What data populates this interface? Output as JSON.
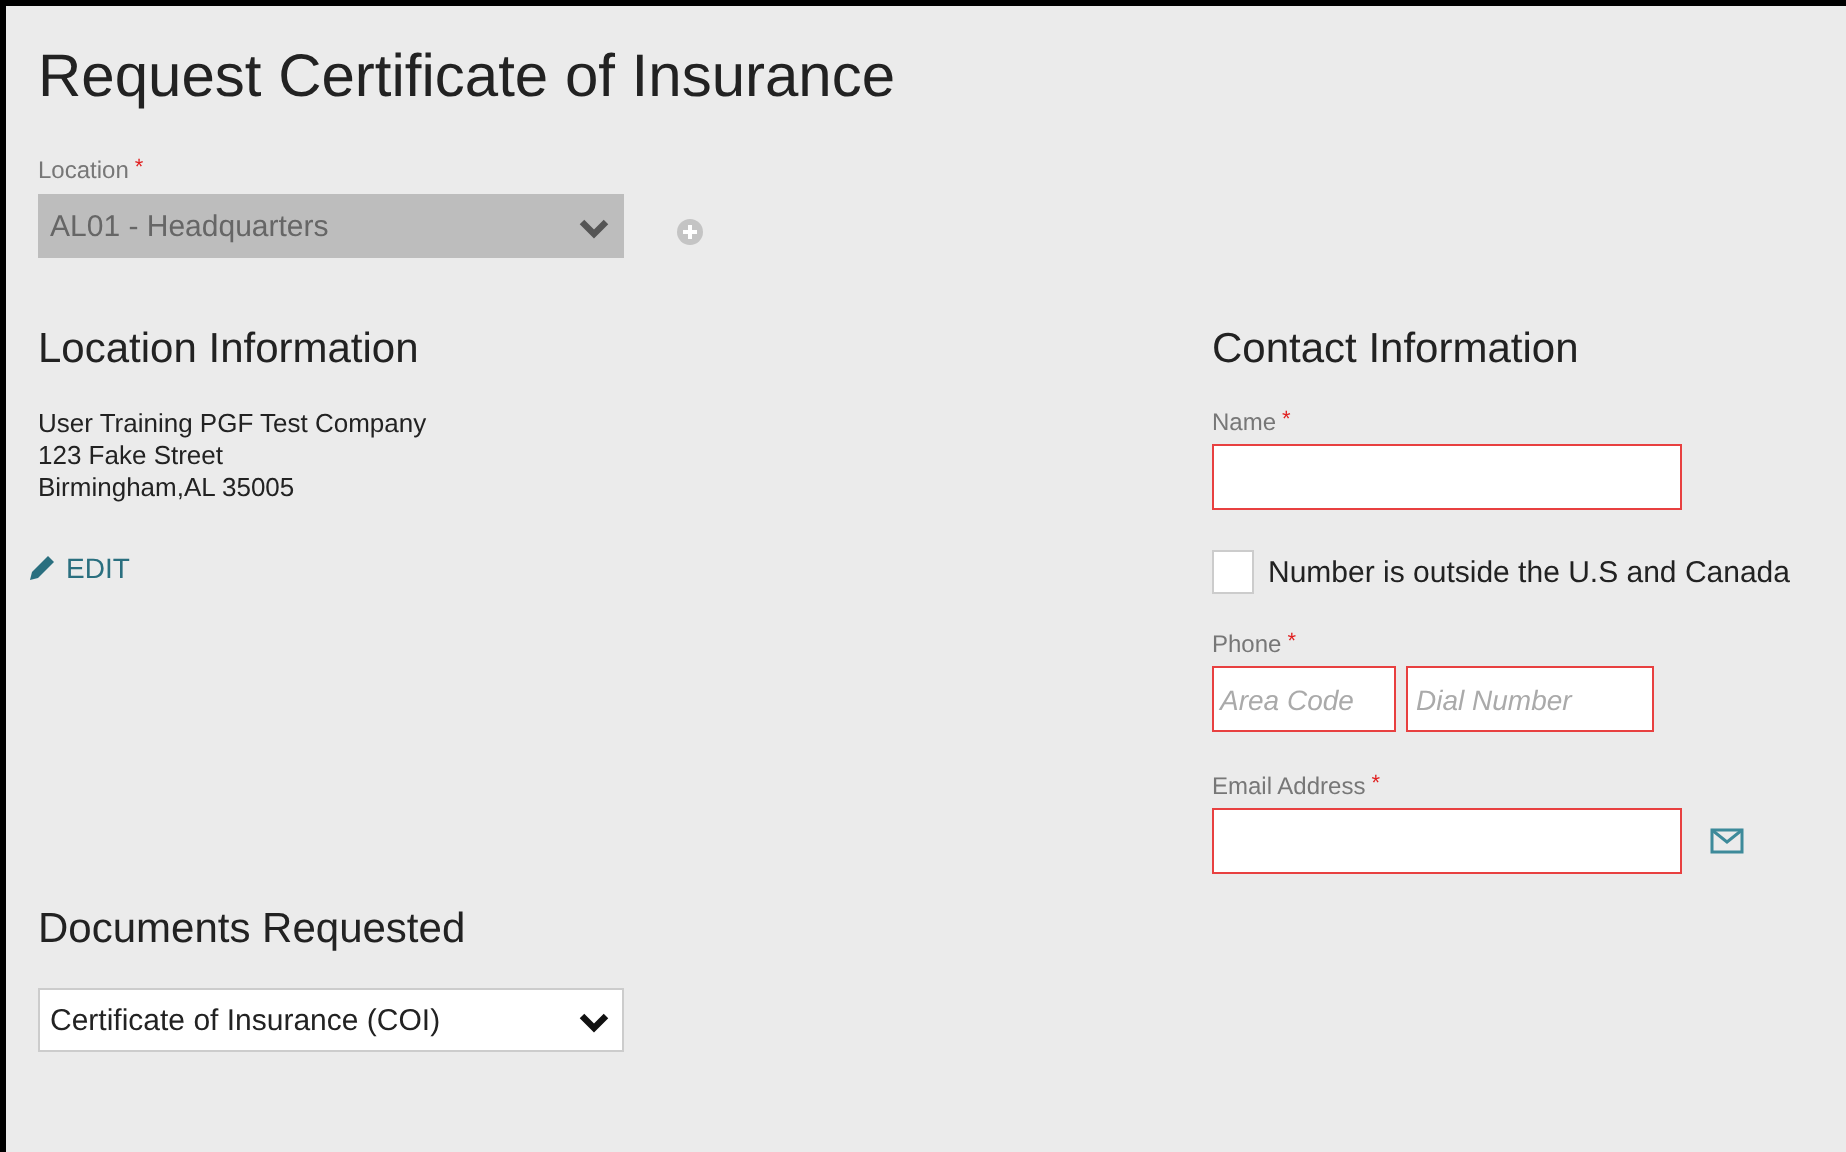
{
  "title": "Request Certificate of Insurance",
  "location": {
    "label": "Location",
    "required_mark": "*",
    "value": "AL01 - Headquarters",
    "disabled": true
  },
  "location_information": {
    "heading": "Location Information",
    "address_lines": [
      "User Training PGF Test Company",
      "123 Fake Street",
      "Birmingham,AL 35005"
    ],
    "edit_link": "EDIT"
  },
  "contact_information": {
    "heading": "Contact Information",
    "name": {
      "label": "Name",
      "required_mark": "*",
      "invalid": true
    },
    "outside_us": {
      "label": "Number is outside the U.S and Canada",
      "checked": false
    },
    "phone": {
      "label": "Phone",
      "required_mark": "*",
      "fields": [
        {
          "placeholder": "Area Code",
          "invalid": true
        },
        {
          "placeholder": "Dial Number",
          "invalid": true
        }
      ]
    },
    "email": {
      "label": "Email Address",
      "required_mark": "*",
      "invalid": true
    }
  },
  "documents_requested": {
    "heading": "Documents Requested",
    "value": "Certificate of Insurance (COI)",
    "disabled": false
  }
}
